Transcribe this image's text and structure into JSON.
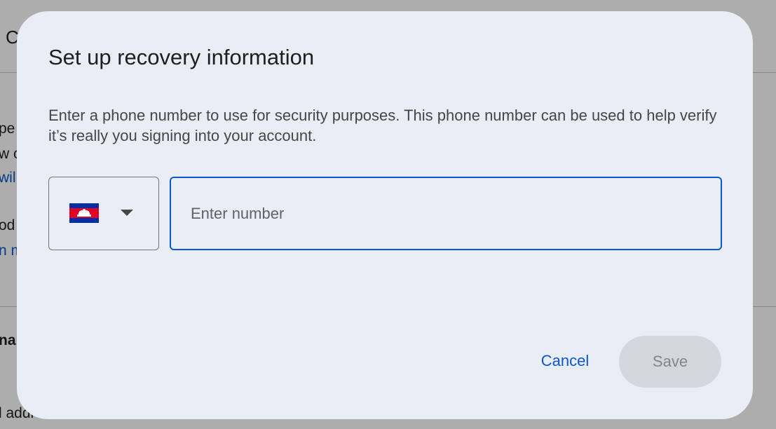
{
  "background": {
    "title_fragment": "C",
    "line1_fragment": "pe",
    "line2_fragment": "w c",
    "link1_fragment": "wil",
    "line3_fragment": "od",
    "link2_fragment": "n m",
    "heading_fragment": "nai",
    "line4_fragment": "l addr"
  },
  "dialog": {
    "title": "Set up recovery information",
    "description": "Enter a phone number to use for security purposes. This phone number can be used to help verify it’s really you signing into your account.",
    "country_select": {
      "flag_icon": "cambodia-flag-icon",
      "arrow_icon": "caret-down-icon"
    },
    "phone_input": {
      "placeholder": "Enter number",
      "value": ""
    },
    "buttons": {
      "cancel_label": "Cancel",
      "save_label": "Save"
    }
  },
  "colors": {
    "dialog_bg": "#e9eef6",
    "accent": "#0b57d0",
    "disabled_button_bg": "#d4d8de",
    "disabled_button_text": "#80868b"
  }
}
